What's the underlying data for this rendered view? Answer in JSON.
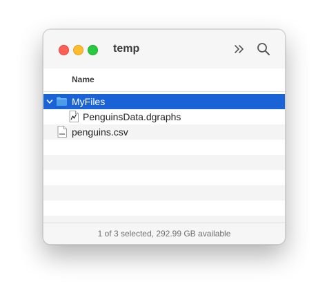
{
  "window": {
    "title": "temp"
  },
  "toolbar": {
    "overflow_icon": "chevron-double-right-icon",
    "search_icon": "search-icon"
  },
  "list_header": {
    "name_label": "Name"
  },
  "files": [
    {
      "name": "MyFiles",
      "kind": "folder",
      "expanded": true,
      "selected": true,
      "indent": 0
    },
    {
      "name": "PenguinsData.dgraphs",
      "kind": "graph-document",
      "selected": false,
      "indent": 1
    },
    {
      "name": "penguins.csv",
      "kind": "csv-document",
      "selected": false,
      "indent": 0
    }
  ],
  "status_bar": {
    "text": "1 of 3 selected, 292.99 GB available"
  },
  "colors": {
    "selection": "#1a63d6",
    "folder": "#5aa6ea",
    "close": "#ff5f57",
    "minimize": "#febc2e",
    "maximize": "#28c840"
  }
}
